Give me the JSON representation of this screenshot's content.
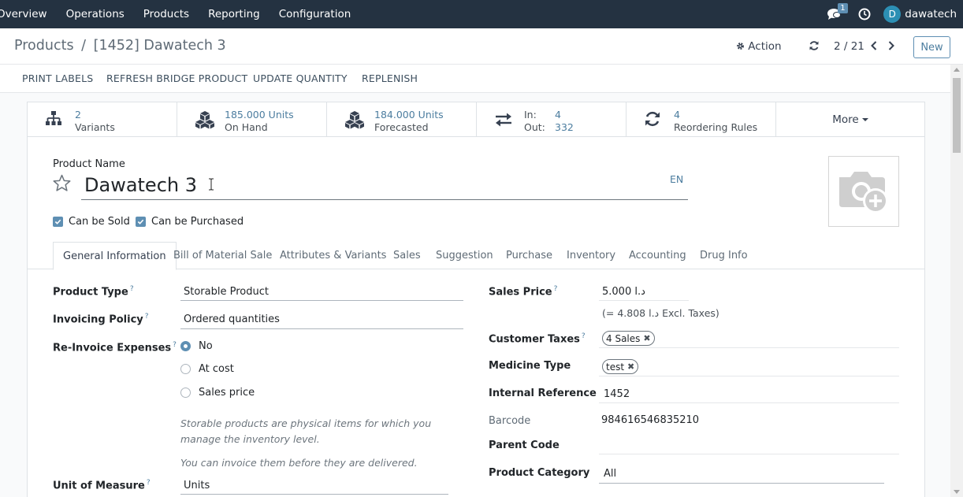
{
  "topnav": {
    "menu": [
      "Overview",
      "Operations",
      "Products",
      "Reporting",
      "Configuration"
    ],
    "chat_count": "1",
    "avatar_letter": "D",
    "username": "dawatech"
  },
  "control": {
    "breadcrumb_parent": "Products",
    "breadcrumb_separator": "/",
    "breadcrumb_current": "[1452] Dawatech 3",
    "action_label": "Action",
    "pager": "2 / 21",
    "new_label": "New"
  },
  "buttonbar": [
    "PRINT LABELS",
    "REFRESH BRIDGE PRODUCT",
    "UPDATE QUANTITY",
    "REPLENISH"
  ],
  "stats": {
    "variants": {
      "value": "2",
      "label": "Variants"
    },
    "on_hand": {
      "value": "185.000 Units",
      "label": "On Hand"
    },
    "forecasted": {
      "value": "184.000 Units",
      "label": "Forecasted"
    },
    "inout": {
      "in_label": "In:",
      "in_value": "4",
      "out_label": "Out:",
      "out_value": "332"
    },
    "reordering": {
      "value": "4",
      "label": "Reordering Rules"
    },
    "more_label": "More"
  },
  "product": {
    "name_label": "Product Name",
    "name": "Dawatech 3",
    "lang": "EN",
    "can_be_sold": "Can be Sold",
    "can_be_purchased": "Can be Purchased"
  },
  "tabs": [
    "General Information",
    "Bill of Material Sale",
    "Attributes & Variants",
    "Sales",
    "Suggestion",
    "Purchase",
    "Inventory",
    "Accounting",
    "Drug Info"
  ],
  "left_fields": {
    "product_type_label": "Product Type",
    "product_type": "Storable Product",
    "invoicing_policy_label": "Invoicing Policy",
    "invoicing_policy": "Ordered quantities",
    "reinvoice_label": "Re-Invoice Expenses",
    "reinvoice_options": [
      "No",
      "At cost",
      "Sales price"
    ],
    "help1": "Storable products are physical items for which you manage the inventory level.",
    "help2": "You can invoice them before they are delivered.",
    "uom_label": "Unit of Measure",
    "uom": "Units"
  },
  "right_fields": {
    "sales_price_label": "Sales Price",
    "sales_price": "5.000 د.ا",
    "excl_taxes": "(= 4.808 د.ا Excl. Taxes)",
    "customer_taxes_label": "Customer Taxes",
    "customer_tax_tag": "4 Sales",
    "medicine_type_label": "Medicine Type",
    "medicine_tag": "test",
    "internal_ref_label": "Internal Reference",
    "internal_ref": "1452",
    "barcode_label": "Barcode",
    "barcode": "984616546835210",
    "parent_code_label": "Parent Code",
    "parent_code": "",
    "category_label": "Product Category",
    "category": "All"
  },
  "colors": {
    "nav": "#243241",
    "accent": "#5e8fb3",
    "link": "#4c7d9f"
  }
}
